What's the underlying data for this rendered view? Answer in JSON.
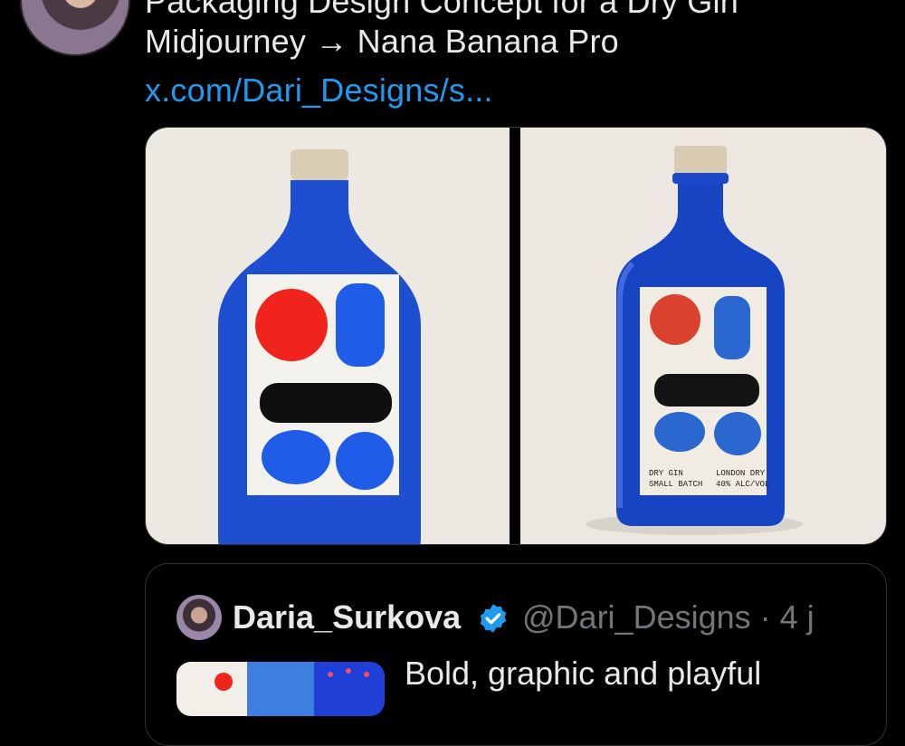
{
  "tweet": {
    "line1": "Packaging Design Concept for a Dry Gin",
    "line2": "Midjourney → Nana Banana Pro",
    "link": "x.com/Dari_Designs/s..."
  },
  "media": {
    "label_left_1": "DRY GIN",
    "label_left_2": "SMALL BATCH",
    "label_right_1": "LONDON DRY",
    "label_right_2": "40% ALC/VOL"
  },
  "quote": {
    "name": "Daria_Surkova",
    "handle": "@Dari_Designs · 4 j",
    "text": "Bold, graphic and playful"
  },
  "colors": {
    "link": "#1d9bf0",
    "verified": "#1d9bf0",
    "bottle_blue": "#1f4fd1",
    "red_shape": "#f0231d"
  }
}
